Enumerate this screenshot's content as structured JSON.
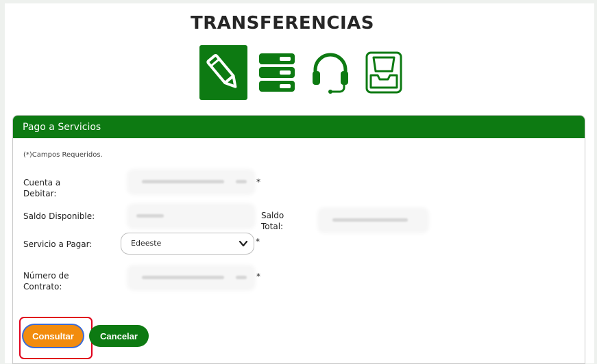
{
  "page": {
    "title": "TRANSFERENCIAS"
  },
  "nav_icons": [
    {
      "name": "edit-pencil-icon",
      "active": true
    },
    {
      "name": "server-list-icon",
      "active": false
    },
    {
      "name": "headset-support-icon",
      "active": false
    },
    {
      "name": "inbox-tray-icon",
      "active": false
    }
  ],
  "colors": {
    "brand_green": "#0d7a12",
    "primary_button": "#f28c0e",
    "highlight_border": "#e0001b"
  },
  "panel": {
    "header": "Pago a Servicios",
    "required_note": "(*)Campos Requeridos.",
    "asterisk": "*"
  },
  "form": {
    "cuenta_label": "Cuenta a Debitar:",
    "saldo_disponible_label": "Saldo Disponible:",
    "saldo_total_label": "Saldo Total:",
    "servicio_label": "Servicio a Pagar:",
    "servicio_value": "Edeeste",
    "contrato_label": "Número de Contrato:"
  },
  "buttons": {
    "consultar": "Consultar",
    "cancelar": "Cancelar"
  }
}
